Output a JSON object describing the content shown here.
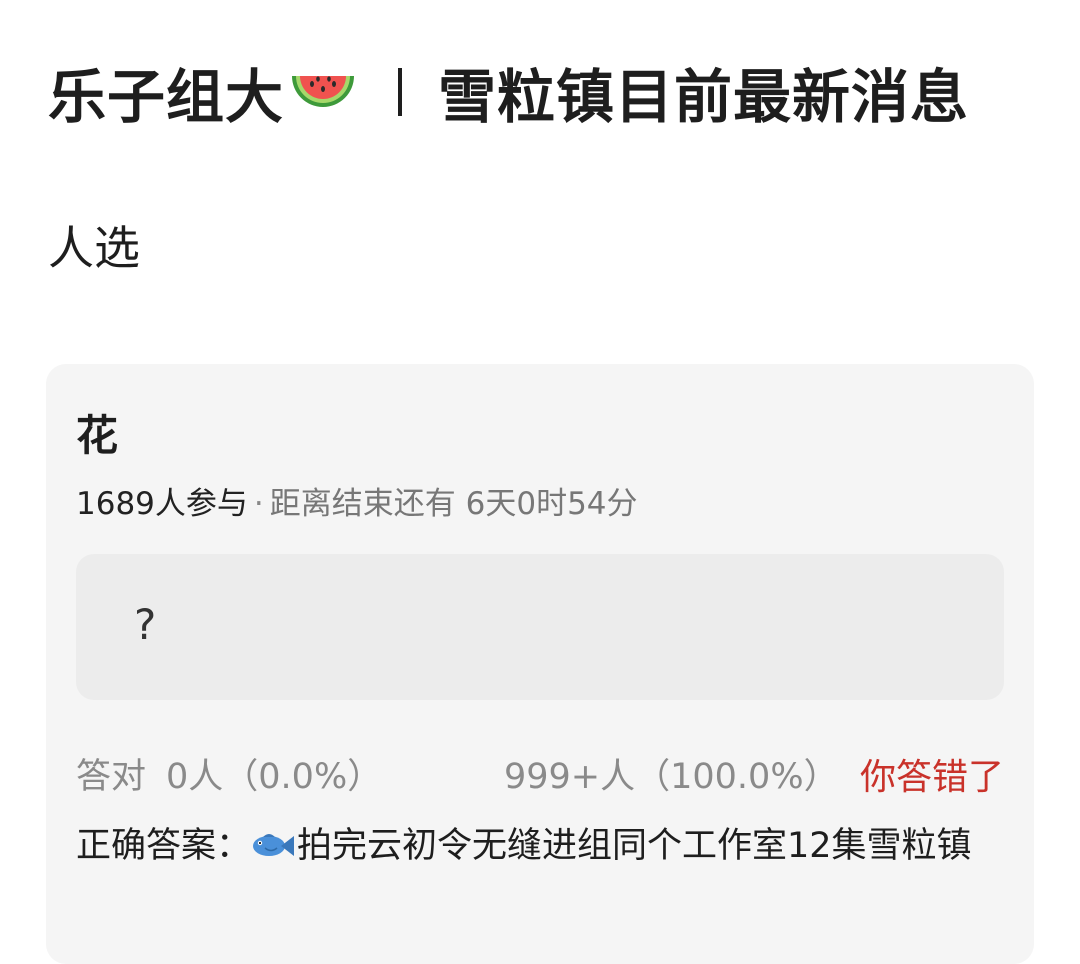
{
  "header": {
    "title_left": "乐子组大",
    "emoji": "watermelon-icon",
    "separator": "丨",
    "title_right": "雪粒镇目前最新消息"
  },
  "subtitle": "人选",
  "quiz": {
    "question": "花",
    "participants": "1689人参与",
    "dot": "·",
    "countdown": "距离结束还有 6天0时54分",
    "option_text": "?",
    "correct_label": "答对",
    "correct_stats": "0人（0.0%）",
    "wrong_stats": "999+人（100.0%）",
    "result": "你答错了",
    "answer_label": "正确答案：",
    "answer_icon": "fish-icon",
    "answer_text": "拍完云初令无缝进组同个工作室12集雪粒镇"
  },
  "colors": {
    "wrong_red": "#c9322a",
    "card_bg": "#f5f5f5",
    "option_bg": "#ececec",
    "muted_text": "#8a8a8a"
  }
}
